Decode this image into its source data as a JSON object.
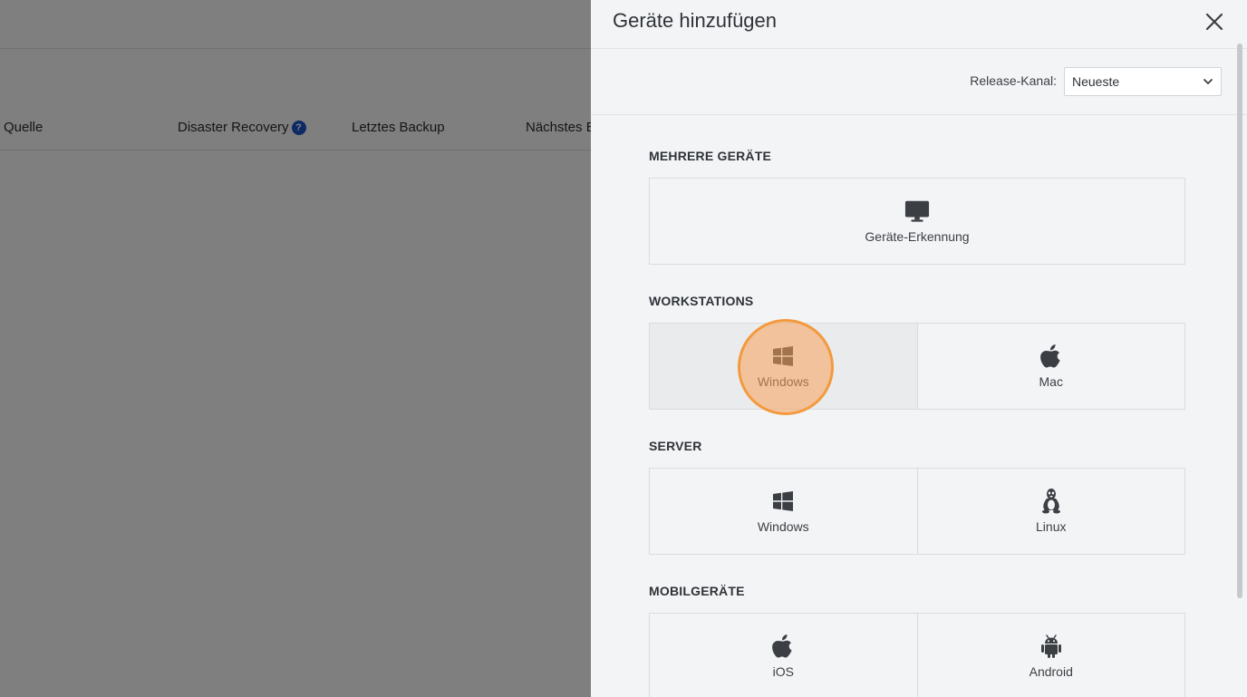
{
  "background": {
    "columns": [
      {
        "label": "Quelle"
      },
      {
        "label": "Disaster Recovery",
        "help": "?"
      },
      {
        "label": "Letztes Backup"
      },
      {
        "label": "Nächstes B"
      }
    ]
  },
  "panel": {
    "title": "Geräte hinzufügen",
    "release": {
      "label": "Release-Kanal:",
      "selected": "Neueste"
    },
    "sections": {
      "multiple": {
        "title": "MEHRERE GERÄTE",
        "items": [
          {
            "label": "Geräte-Erkennung",
            "icon": "monitor-icon"
          }
        ]
      },
      "workstations": {
        "title": "WORKSTATIONS",
        "items": [
          {
            "label": "Windows",
            "icon": "windows-icon"
          },
          {
            "label": "Mac",
            "icon": "apple-icon"
          }
        ]
      },
      "server": {
        "title": "SERVER",
        "items": [
          {
            "label": "Windows",
            "icon": "windows-icon"
          },
          {
            "label": "Linux",
            "icon": "linux-icon"
          }
        ]
      },
      "mobile": {
        "title": "MOBILGERÄTE",
        "items": [
          {
            "label": "iOS",
            "icon": "apple-icon"
          },
          {
            "label": "Android",
            "icon": "android-icon"
          }
        ]
      }
    }
  },
  "colors": {
    "icon": "#3b3f44",
    "help": "#1a55c9",
    "highlight": "#f39a3e"
  }
}
